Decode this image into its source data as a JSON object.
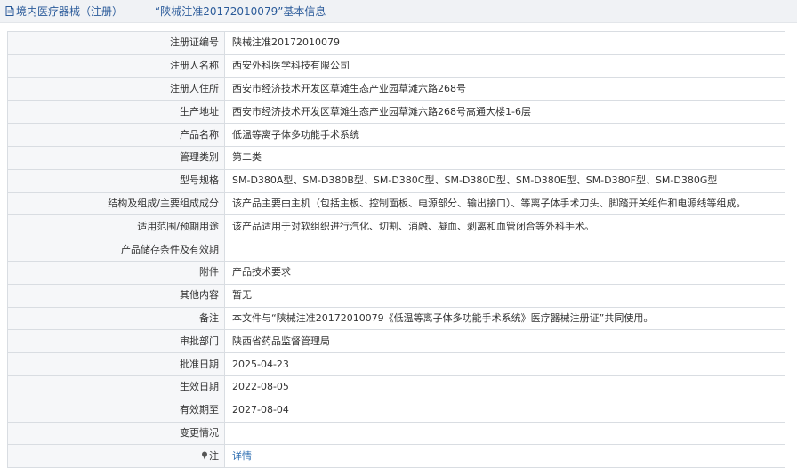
{
  "header": {
    "title": "境内医疗器械（注册）",
    "separator": "——",
    "record": "“陕械注准20172010079”基本信息",
    "icon": "document-icon"
  },
  "rows": [
    {
      "label": "注册证编号",
      "value": "陕械注准20172010079"
    },
    {
      "label": "注册人名称",
      "value": "西安外科医学科技有限公司"
    },
    {
      "label": "注册人住所",
      "value": "西安市经济技术开发区草滩生态产业园草滩六路268号"
    },
    {
      "label": "生产地址",
      "value": "西安市经济技术开发区草滩生态产业园草滩六路268号高通大楼1-6层"
    },
    {
      "label": "产品名称",
      "value": "低温等离子体多功能手术系统"
    },
    {
      "label": "管理类别",
      "value": "第二类"
    },
    {
      "label": "型号规格",
      "value": "SM-D380A型、SM-D380B型、SM-D380C型、SM-D380D型、SM-D380E型、SM-D380F型、SM-D380G型"
    },
    {
      "label": "结构及组成/主要组成成分",
      "value": "该产品主要由主机（包括主板、控制面板、电源部分、输出接口）、等离子体手术刀头、脚踏开关组件和电源线等组成。"
    },
    {
      "label": "适用范围/预期用途",
      "value": "该产品适用于对软组织进行汽化、切割、消融、凝血、剥离和血管闭合等外科手术。"
    },
    {
      "label": "产品储存条件及有效期",
      "value": ""
    },
    {
      "label": "附件",
      "value": "产品技术要求"
    },
    {
      "label": "其他内容",
      "value": "暂无"
    },
    {
      "label": "备注",
      "value": "本文件与“陕械注准20172010079《低温等离子体多功能手术系统》医疗器械注册证”共同使用。"
    },
    {
      "label": "审批部门",
      "value": "陕西省药品监督管理局"
    },
    {
      "label": "批准日期",
      "value": "2025-04-23"
    },
    {
      "label": "生效日期",
      "value": "2022-08-05"
    },
    {
      "label": "有效期至",
      "value": "2027-08-04"
    },
    {
      "label": "变更情况",
      "value": ""
    }
  ],
  "note_row": {
    "label": "注",
    "icon": "pin-icon",
    "link": "详情"
  },
  "colors": {
    "header_text": "#2b5b9a",
    "link": "#2b6cb0",
    "label_bg": "#f6f7f9",
    "border": "#d9dde2"
  }
}
